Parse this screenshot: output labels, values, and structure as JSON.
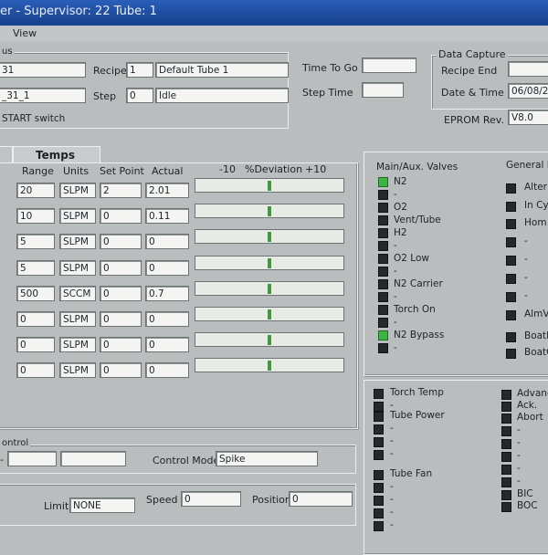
{
  "window": {
    "title": "er - Supervisor: 22 Tube: 1"
  },
  "menu": {
    "view": "View"
  },
  "status_group": {
    "legend": "us"
  },
  "run": {
    "id1": "31",
    "id2": "_31_1",
    "recipe_label": "Recipe",
    "recipe_num": "1",
    "recipe_name": "Default Tube 1",
    "step_label": "Step",
    "step_num": "0",
    "step_name": "Idle",
    "time_to_go_label": "Time To Go",
    "step_time_label": "Step Time",
    "start_text": "START switch"
  },
  "data_capture": {
    "legend": "Data Capture",
    "recipe_end_label": "Recipe End",
    "date_time_label": "Date & Time",
    "date_time_value": "06/08/2",
    "eprom_label": "EPROM Rev.",
    "eprom_value": "V8.0"
  },
  "tabs": {
    "temps": "Temps"
  },
  "flow_headers": {
    "range": "Range",
    "units": "Units",
    "set_point": "Set Point",
    "actual": "Actual",
    "minus10": "-10",
    "deviation": "%Deviation",
    "plus10": "+10"
  },
  "flow_rows": [
    {
      "range": "20",
      "units": "SLPM",
      "setpoint": "2",
      "actual": "2.01"
    },
    {
      "range": "10",
      "units": "SLPM",
      "setpoint": "0",
      "actual": "0.11"
    },
    {
      "range": "5",
      "units": "SLPM",
      "setpoint": "0",
      "actual": "0"
    },
    {
      "range": "5",
      "units": "SLPM",
      "setpoint": "0",
      "actual": "0"
    },
    {
      "range": "500",
      "units": "SCCM",
      "setpoint": "0",
      "actual": "0.7"
    },
    {
      "range": "0",
      "units": "SLPM",
      "setpoint": "0",
      "actual": "0"
    },
    {
      "range": "0",
      "units": "SLPM",
      "setpoint": "0",
      "actual": "0"
    },
    {
      "range": "0",
      "units": "SLPM",
      "setpoint": "0",
      "actual": "0"
    }
  ],
  "valves": {
    "title": "Main/Aux. Valves",
    "items": [
      "N2",
      "-",
      "O2",
      "Vent/Tube",
      "H2",
      "-",
      "O2 Low",
      "-",
      "N2 Carrier",
      "-",
      "Torch On",
      "-",
      "N2 Bypass",
      "-"
    ],
    "colors": {
      "on": "#3db443",
      "off": "#23292c"
    }
  },
  "general": {
    "title": "General F",
    "items": [
      "Alter",
      "In Cy",
      "Hom",
      "-",
      "-",
      "-",
      "-",
      "AlmV",
      "Boatl",
      "BoatC"
    ]
  },
  "io_left": [
    "Torch Temp",
    "-",
    "Tube Power",
    "-",
    "-",
    "-",
    "Tube Fan",
    "-",
    "-",
    "-",
    "-"
  ],
  "io_right": [
    "Advanc",
    "Ack.",
    "Abort",
    "-",
    "-",
    "-",
    "-",
    "-",
    "BIC",
    "BOC"
  ],
  "control": {
    "legend": "ontrol",
    "dash": "-",
    "mode_label": "Control Mode",
    "mode_value": "Spike"
  },
  "motion": {
    "limit_label": "Limit",
    "limit_value": "NONE",
    "speed_label": "Speed",
    "speed_value": "0",
    "position_label": "Position",
    "position_value": "0"
  }
}
